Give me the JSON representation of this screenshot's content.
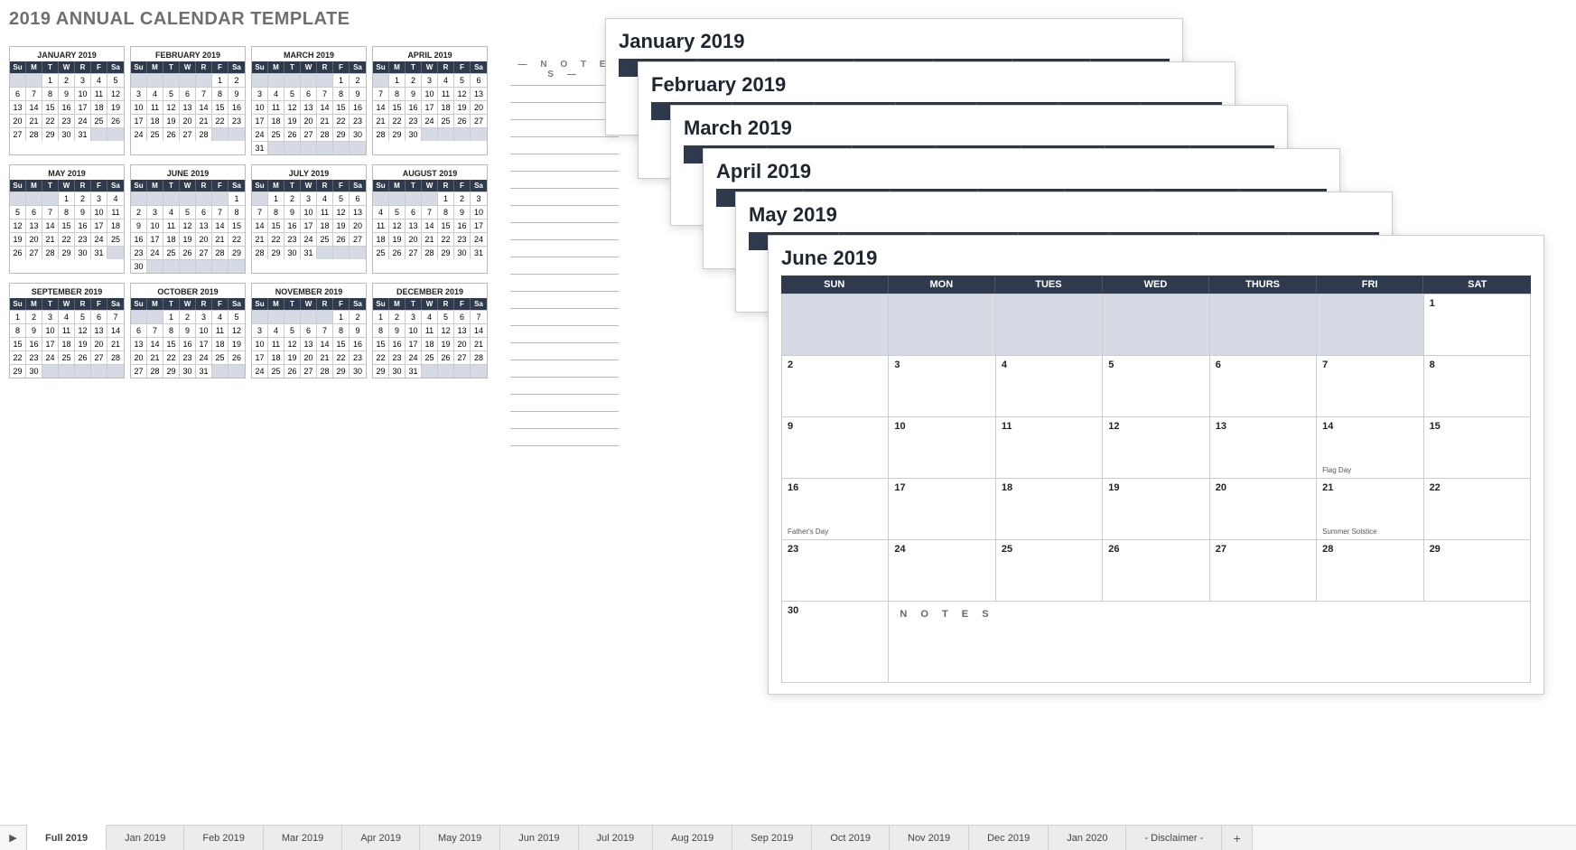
{
  "title": "2019 ANNUAL CALENDAR TEMPLATE",
  "notesHeading": "— N O T E S —",
  "dayAbbr": [
    "Su",
    "M",
    "T",
    "W",
    "R",
    "F",
    "Sa"
  ],
  "dayFull": [
    "SUN",
    "MON",
    "TUES",
    "WED",
    "THURS",
    "FRI",
    "SAT"
  ],
  "months": [
    {
      "name": "JANUARY 2019",
      "start": 2,
      "days": 31
    },
    {
      "name": "FEBRUARY 2019",
      "start": 5,
      "days": 28
    },
    {
      "name": "MARCH 2019",
      "start": 5,
      "days": 31
    },
    {
      "name": "APRIL 2019",
      "start": 1,
      "days": 30
    },
    {
      "name": "MAY 2019",
      "start": 3,
      "days": 31
    },
    {
      "name": "JUNE 2019",
      "start": 6,
      "days": 30
    },
    {
      "name": "JULY 2019",
      "start": 1,
      "days": 31
    },
    {
      "name": "AUGUST 2019",
      "start": 4,
      "days": 31
    },
    {
      "name": "SEPTEMBER 2019",
      "start": 0,
      "days": 30
    },
    {
      "name": "OCTOBER 2019",
      "start": 2,
      "days": 31
    },
    {
      "name": "NOVEMBER 2019",
      "start": 5,
      "days": 30
    },
    {
      "name": "DECEMBER 2019",
      "start": 0,
      "days": 31
    }
  ],
  "stackTitles": [
    "January 2019",
    "February 2019",
    "March 2019",
    "April 2019",
    "May 2019",
    "June 2019"
  ],
  "june": {
    "title": "June 2019",
    "start": 6,
    "days": 30,
    "events": {
      "14": "Flag Day",
      "16": "Father's Day",
      "21": "Summer Solstice"
    },
    "trailingDay": "30",
    "notesLabel": "N O T E S"
  },
  "tabs": {
    "nav": "▶",
    "list": [
      "Full 2019",
      "Jan 2019",
      "Feb 2019",
      "Mar 2019",
      "Apr 2019",
      "May 2019",
      "Jun 2019",
      "Jul 2019",
      "Aug 2019",
      "Sep 2019",
      "Oct 2019",
      "Nov 2019",
      "Dec 2019",
      "Jan 2020",
      "- Disclaimer -"
    ],
    "active": "Full 2019",
    "add": "+"
  }
}
